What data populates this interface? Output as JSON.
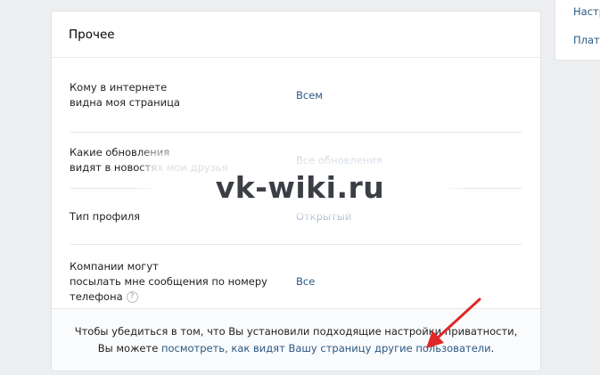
{
  "side_menu": {
    "items": [
      {
        "label": "Настр"
      },
      {
        "label": "Плате"
      }
    ]
  },
  "card": {
    "title": "Прочее",
    "rows": [
      {
        "label": "Кому в интернете\nвидна моя страница",
        "value": "Всем"
      },
      {
        "label": "Какие обновления\nвидят в новостях мои друзья",
        "value": "Все обновления"
      },
      {
        "label": "Тип профиля",
        "value": "Открытый"
      },
      {
        "label": "Компании могут\nпосылать мне сообщения по номеру\nтелефона",
        "value": "Все",
        "help_icon": "?"
      }
    ],
    "footer": {
      "text_line1": "Чтобы убедиться в том, что Вы установили подходящие настройки приватности,",
      "text_line2_prefix": "Вы можете ",
      "link": "посмотреть, как видят Вашу страницу другие пользователи",
      "text_line2_suffix": "."
    }
  },
  "watermark": "vk-wiki.ru",
  "colors": {
    "background": "#edeef0",
    "link": "#2a5885",
    "arrow": "#e02727"
  },
  "icons": {
    "help": "question-circle-icon",
    "annotation": "red-arrow-icon"
  }
}
